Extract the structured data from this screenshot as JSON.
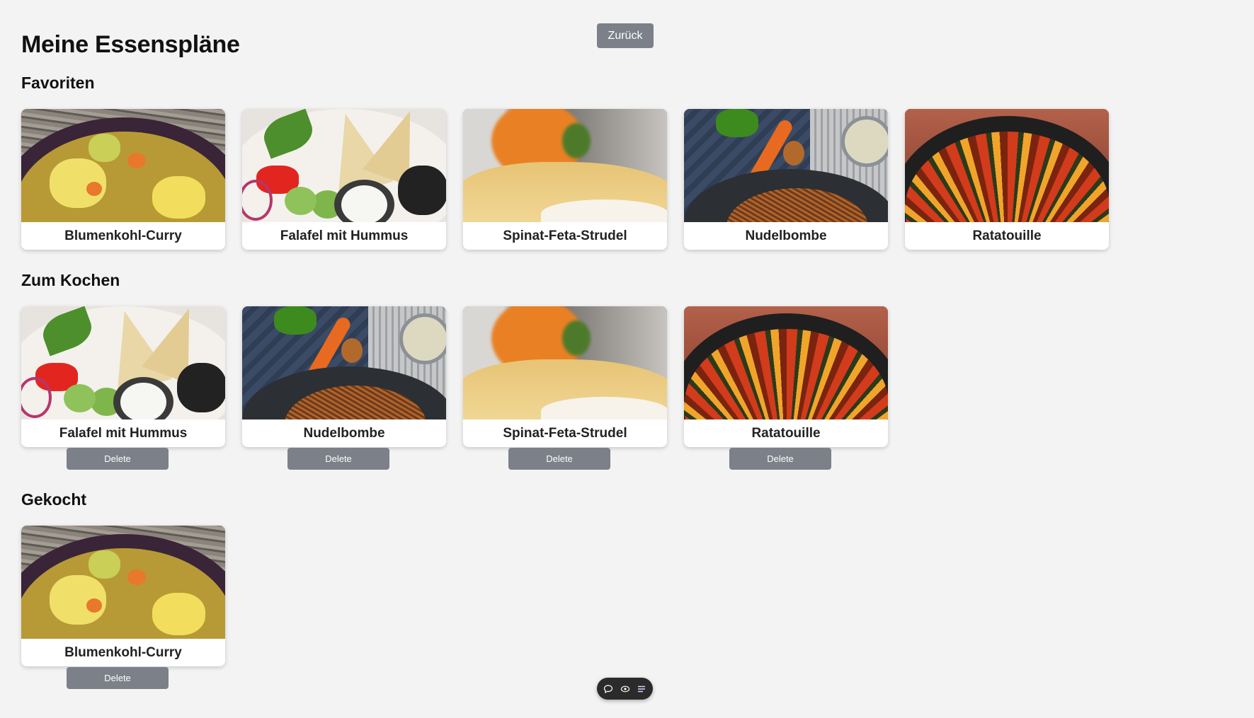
{
  "header": {
    "back_label": "Zurück",
    "title": "Meine Essenspläne"
  },
  "sections": [
    {
      "title": "Favoriten",
      "items": [
        {
          "name": "Blumenkohl-Curry",
          "image": "curry"
        },
        {
          "name": "Falafel mit Hummus",
          "image": "falafel"
        },
        {
          "name": "Spinat-Feta-Strudel",
          "image": "strudel"
        },
        {
          "name": "Nudelbombe",
          "image": "nudel"
        },
        {
          "name": "Ratatouille",
          "image": "rata"
        }
      ]
    },
    {
      "title": "Zum Kochen",
      "items": [
        {
          "name": "Falafel mit Hummus",
          "image": "falafel"
        },
        {
          "name": "Nudelbombe",
          "image": "nudel"
        },
        {
          "name": "Spinat-Feta-Strudel",
          "image": "strudel"
        },
        {
          "name": "Ratatouille",
          "image": "rata"
        }
      ]
    },
    {
      "title": "Gekocht",
      "items": [
        {
          "name": "Blumenkohl-Curry",
          "image": "curry"
        }
      ]
    }
  ],
  "delete_label": "Delete",
  "dock": {
    "icons": [
      "comment-icon",
      "eye-icon",
      "list-icon"
    ]
  },
  "colors": {
    "background": "#f3f3f3",
    "button": "#7b8089",
    "card": "#ffffff"
  }
}
